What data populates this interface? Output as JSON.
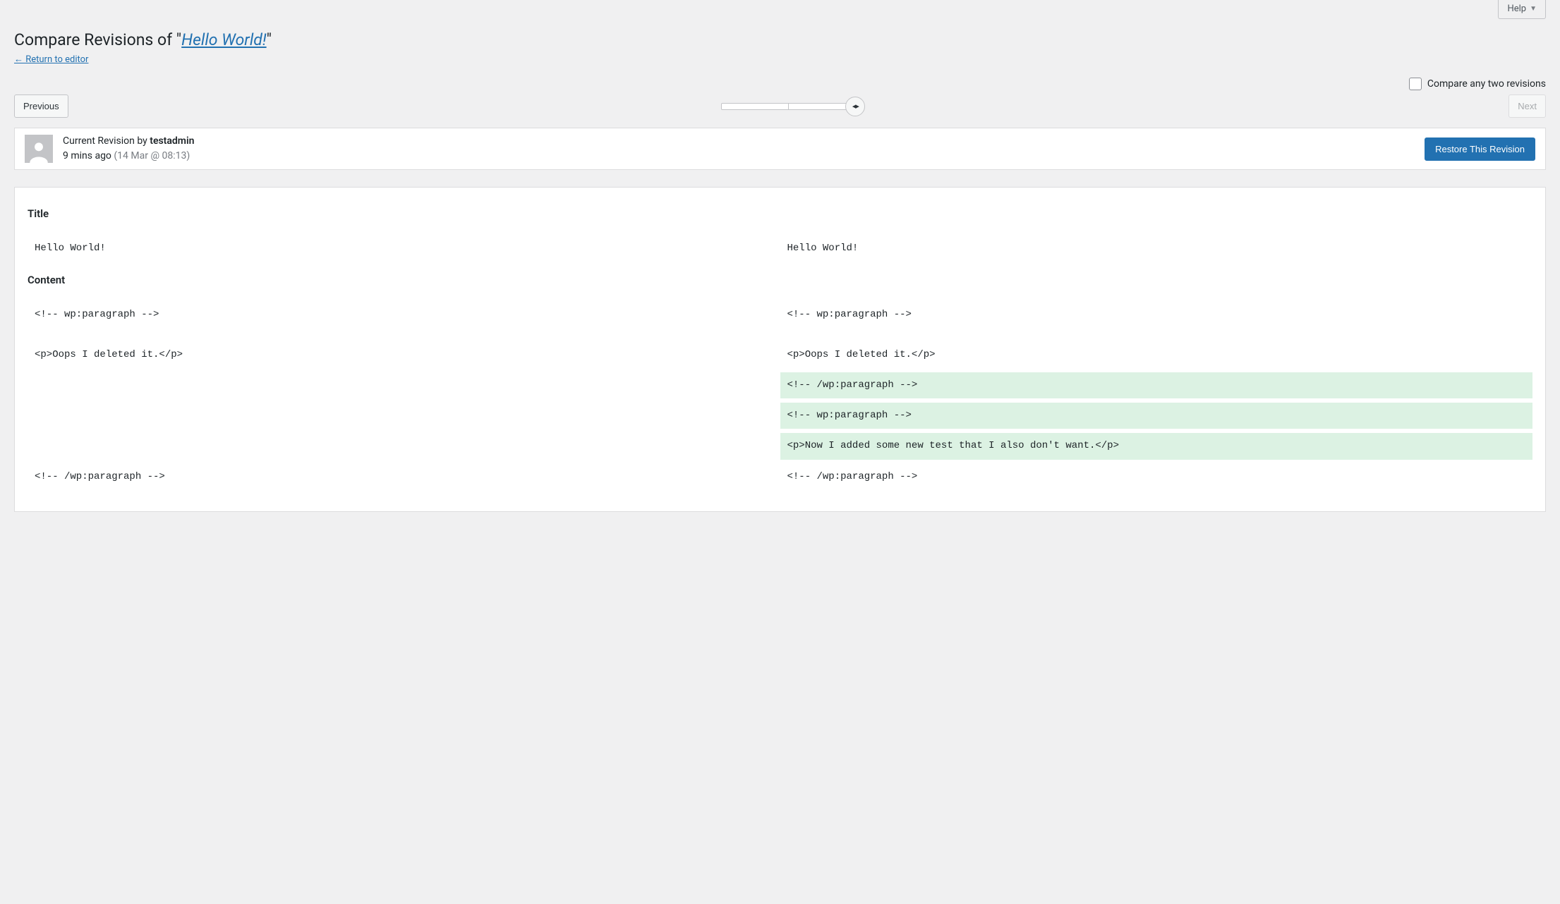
{
  "help_label": "Help",
  "page_title_prefix": "Compare Revisions of \"",
  "page_title_link": "Hello World!",
  "page_title_suffix": "\"",
  "return_link": "← Return to editor",
  "compare_any_label": "Compare any two revisions",
  "prev_button": "Previous",
  "next_button": "Next",
  "meta": {
    "label": "Current Revision by ",
    "author": "testadmin",
    "time_rel": "9 mins ago ",
    "time_abs": "(14 Mar @ 08:13)"
  },
  "restore_button": "Restore This Revision",
  "diff": {
    "title_heading": "Title",
    "title_left": "Hello World!",
    "title_right": "Hello World!",
    "content_heading": "Content",
    "rows": [
      {
        "left": "<!-- wp:paragraph -->",
        "right": "<!-- wp:paragraph -->",
        "state": "same"
      },
      {
        "spacer": true
      },
      {
        "left": "<p>Oops I deleted it.</p>",
        "right": "<p>Oops I deleted it.</p>",
        "state": "same"
      },
      {
        "left": "",
        "right": "<!-- /wp:paragraph -->",
        "state": "added"
      },
      {
        "left": "",
        "right": "<!-- wp:paragraph -->",
        "state": "added"
      },
      {
        "left": "",
        "right": "<p>Now I added some new test that I also don't want.</p>",
        "state": "added"
      },
      {
        "left": "<!-- /wp:paragraph -->",
        "right": "<!-- /wp:paragraph -->",
        "state": "same"
      }
    ]
  }
}
